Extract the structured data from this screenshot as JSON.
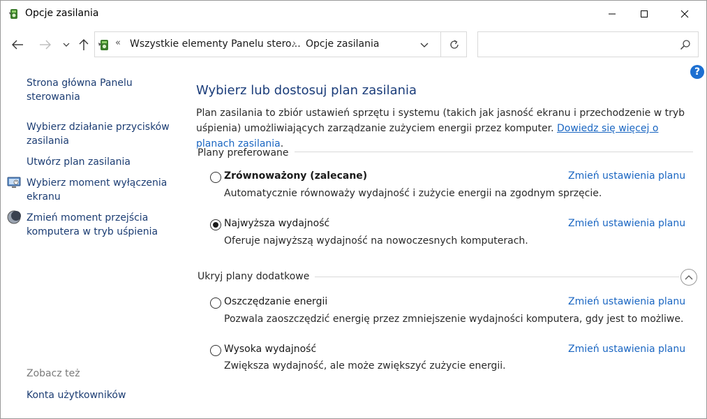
{
  "window": {
    "title": "Opcje zasilania"
  },
  "address": {
    "crumb1": "Wszystkie elementy Panelu stero...",
    "crumb2": "Opcje zasilania",
    "search_placeholder": ""
  },
  "help": {
    "label": "?"
  },
  "sidebar": {
    "links": [
      {
        "label": "Strona główna Panelu sterowania",
        "icon": ""
      },
      {
        "label": "Wybierz działanie przycisków zasilania",
        "icon": ""
      },
      {
        "label": "Utwórz plan zasilania",
        "icon": ""
      },
      {
        "label": "Wybierz moment wyłączenia ekranu",
        "icon": "monitor-icon"
      },
      {
        "label": "Zmień moment przejścia komputera w tryb uśpienia",
        "icon": "moon-icon"
      }
    ],
    "see_also": "Zobacz też",
    "accounts": "Konta użytkowników"
  },
  "main": {
    "heading": "Wybierz lub dostosuj plan zasilania",
    "intro_text": "Plan zasilania to zbiór ustawień sprzętu i systemu (takich jak jasność ekranu i przechodzenie w tryb uśpienia) umożliwiających zarządzanie zużyciem energii przez komputer. ",
    "intro_link": "Dowiedz się więcej o planach zasilania",
    "intro_end": ".",
    "preferred_label": "Plany preferowane",
    "additional_label": "Ukryj plany dodatkowe",
    "plans": [
      {
        "name": "Zrównoważony (zalecane)",
        "desc": "Automatycznie równoważy wydajność i zużycie energii na zgodnym sprzęcie.",
        "link": "Zmień ustawienia planu",
        "selected": false,
        "bold": true
      },
      {
        "name": "Najwyższa wydajność",
        "desc": "Oferuje najwyższą wydajność na nowoczesnych komputerach.",
        "link": "Zmień ustawienia planu",
        "selected": true,
        "bold": false
      },
      {
        "name": "Oszczędzanie energii",
        "desc": "Pozwala zaoszczędzić energię przez zmniejszenie wydajności komputera, gdy jest to możliwe.",
        "link": "Zmień ustawienia planu",
        "selected": false,
        "bold": false
      },
      {
        "name": "Wysoka wydajność",
        "desc": "Zwiększa wydajność, ale może zwiększyć zużycie energii.",
        "link": "Zmień ustawienia planu",
        "selected": false,
        "bold": false
      }
    ]
  },
  "colors": {
    "link": "#1a66c2",
    "heading": "#1b3d7a",
    "sidebar_link": "#1c3d73",
    "help": "#1c6fd1"
  }
}
